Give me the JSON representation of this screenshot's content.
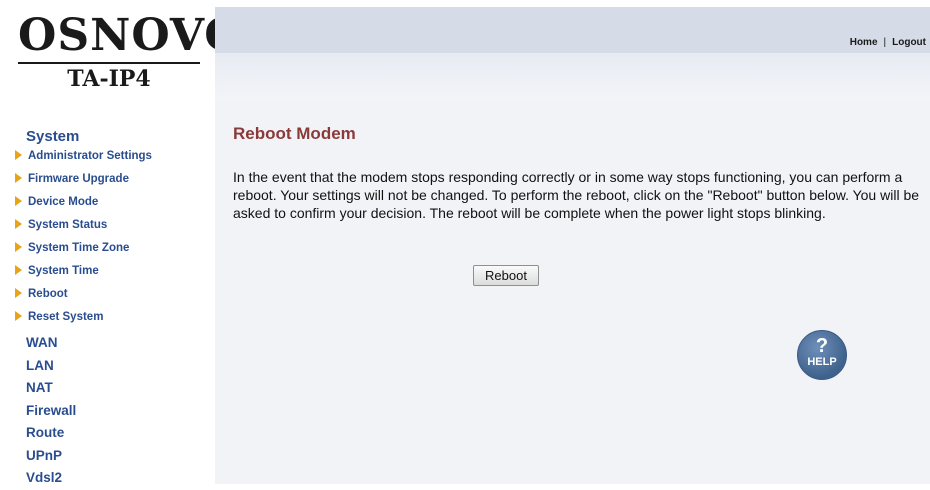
{
  "brand": {
    "name": "OSNOVO",
    "model": "TA-IP4"
  },
  "header": {
    "home_label": "Home",
    "separator": "|",
    "logout_label": "Logout"
  },
  "sidebar": {
    "system_label": "System",
    "system_items": [
      {
        "label": "Administrator Settings"
      },
      {
        "label": "Firmware Upgrade"
      },
      {
        "label": "Device Mode"
      },
      {
        "label": "System Status"
      },
      {
        "label": "System Time Zone"
      },
      {
        "label": "System Time"
      },
      {
        "label": "Reboot"
      },
      {
        "label": "Reset System"
      }
    ],
    "sections": [
      {
        "label": "WAN"
      },
      {
        "label": "LAN"
      },
      {
        "label": "NAT"
      },
      {
        "label": "Firewall"
      },
      {
        "label": "Route"
      },
      {
        "label": "UPnP"
      },
      {
        "label": "Vdsl2"
      }
    ]
  },
  "main": {
    "title": "Reboot Modem",
    "description": "In the event that the modem stops responding correctly or in some way stops functioning, you can perform a reboot. Your settings will not be changed. To perform the reboot, click on the \"Reboot\" button below. You will be asked to confirm your decision. The reboot will be complete when the power light stops blinking.",
    "reboot_button": "Reboot",
    "help_label": "HELP",
    "help_glyph": "?"
  },
  "colors": {
    "accent": "#2a4d8f",
    "title": "#8b3a3a",
    "bullet": "#e8a317",
    "topbar": "#d6dbe8"
  }
}
